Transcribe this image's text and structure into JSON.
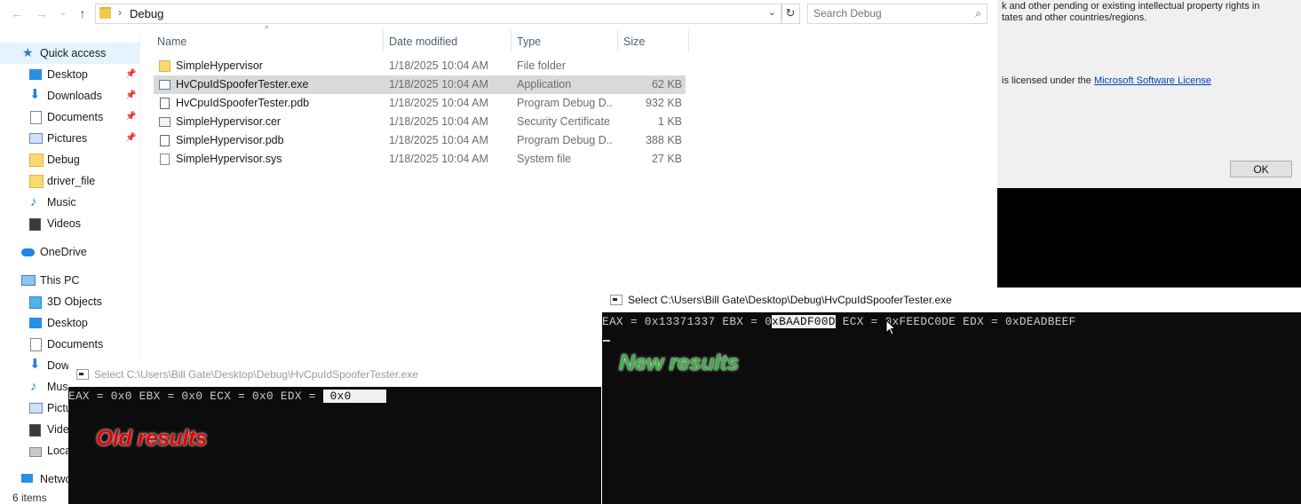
{
  "address": {
    "path": "Debug",
    "separator": "›"
  },
  "search": {
    "placeholder": "Search Debug"
  },
  "nav": {
    "items": [
      {
        "label": "Quick access",
        "icon": "star-icon"
      },
      {
        "label": "Desktop",
        "icon": "desktop-icon"
      },
      {
        "label": "Downloads",
        "icon": "download-icon"
      },
      {
        "label": "Documents",
        "icon": "documents-icon"
      },
      {
        "label": "Pictures",
        "icon": "pictures-icon"
      },
      {
        "label": "Debug",
        "icon": "folder-icon"
      },
      {
        "label": "driver_file",
        "icon": "folder-icon"
      },
      {
        "label": "Music",
        "icon": "music-icon"
      },
      {
        "label": "Videos",
        "icon": "videos-icon"
      },
      {
        "label": "OneDrive",
        "icon": "cloud-icon"
      },
      {
        "label": "This PC",
        "icon": "computer-icon"
      },
      {
        "label": "3D Objects",
        "icon": "cube-icon"
      },
      {
        "label": "Desktop",
        "icon": "desktop-icon"
      },
      {
        "label": "Documents",
        "icon": "documents-icon"
      },
      {
        "label": "Dow",
        "icon": "download-icon"
      },
      {
        "label": "Mus",
        "icon": "music-icon"
      },
      {
        "label": "Pictu",
        "icon": "pictures-icon"
      },
      {
        "label": "Vide",
        "icon": "videos-icon"
      },
      {
        "label": "Loca",
        "icon": "drive-icon"
      },
      {
        "label": "Netwo",
        "icon": "network-icon"
      }
    ],
    "status": "6 items"
  },
  "columns": {
    "name": "Name",
    "date": "Date modified",
    "type": "Type",
    "size": "Size"
  },
  "files": [
    {
      "name": "SimpleHypervisor",
      "date": "1/18/2025 10:04 AM",
      "type": "File folder",
      "size": "",
      "icon": "folder-icon"
    },
    {
      "name": "HvCpuIdSpooferTester.exe",
      "date": "1/18/2025 10:04 AM",
      "type": "Application",
      "size": "62 KB",
      "icon": "application-icon"
    },
    {
      "name": "HvCpuIdSpooferTester.pdb",
      "date": "1/18/2025 10:04 AM",
      "type": "Program Debug D...",
      "size": "932 KB",
      "icon": "pdb-icon"
    },
    {
      "name": "SimpleHypervisor.cer",
      "date": "1/18/2025 10:04 AM",
      "type": "Security Certificate",
      "size": "1 KB",
      "icon": "certificate-icon"
    },
    {
      "name": "SimpleHypervisor.pdb",
      "date": "1/18/2025 10:04 AM",
      "type": "Program Debug D...",
      "size": "388 KB",
      "icon": "pdb-icon"
    },
    {
      "name": "SimpleHypervisor.sys",
      "date": "1/18/2025 10:04 AM",
      "type": "System file",
      "size": "27 KB",
      "icon": "system-file-icon"
    }
  ],
  "license": {
    "line1": "k and other pending or existing intellectual property rights in",
    "line2": "tates and other countries/regions.",
    "line3_prefix": "is licensed under the ",
    "link": "Microsoft Software License",
    "ok": "OK"
  },
  "console_old": {
    "title": "Select C:\\Users\\Bill Gate\\Desktop\\Debug\\HvCpuIdSpooferTester.exe",
    "output_plain": "EAX = 0x0 EBX = 0x0 ECX = 0x0 EDX = ",
    "output_selected": " 0x0     ",
    "annotation": "Old results",
    "annotation_color": "#e00000"
  },
  "console_new": {
    "title": "Select C:\\Users\\Bill Gate\\Desktop\\Debug\\HvCpuIdSpooferTester.exe",
    "output_before": "EAX = 0x13371337 EBX = 0",
    "output_selected": "xBAADF00D",
    "output_after": " ECX = 0xFEEDC0DE EDX = 0xDEADBEEF",
    "annotation": "New results",
    "annotation_color": "#3cb043"
  }
}
